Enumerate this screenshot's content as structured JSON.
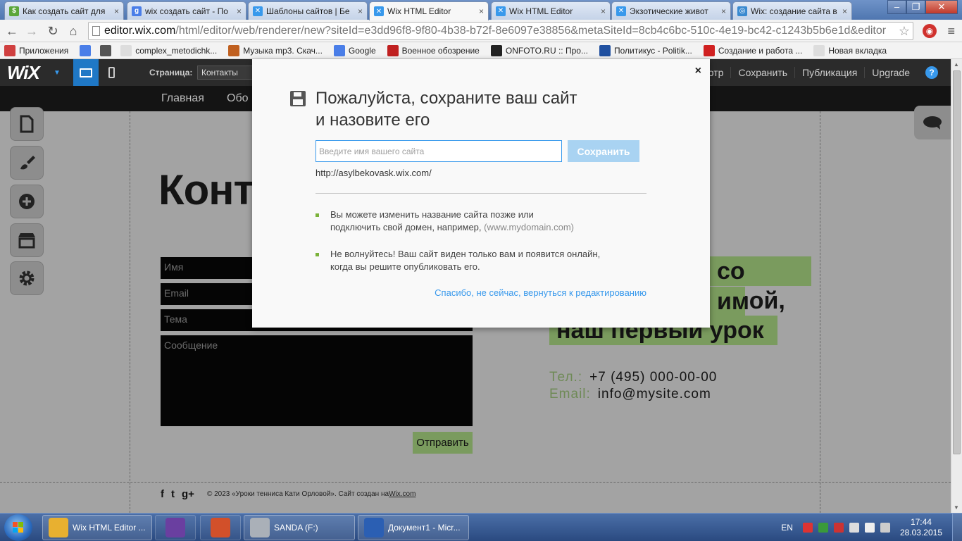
{
  "browser": {
    "tabs": [
      {
        "title": "Как создать сайт для",
        "fav": "$",
        "color": "#5ba63a"
      },
      {
        "title": "wix создать сайт - По",
        "fav": "g",
        "color": "#4a7ee8"
      },
      {
        "title": "Шаблоны сайтов | Бе",
        "fav": "✕",
        "color": "#3899ec"
      },
      {
        "title": "Wix HTML Editor",
        "fav": "✕",
        "color": "#3899ec"
      },
      {
        "title": "Wix HTML Editor",
        "fav": "✕",
        "color": "#3899ec"
      },
      {
        "title": "Экзотические живот",
        "fav": "✕",
        "color": "#3899ec"
      },
      {
        "title": "Wix: создание сайта в",
        "fav": "◎",
        "color": "#3a8ad0"
      }
    ],
    "url_host": "editor.wix.com",
    "url_path": "/html/editor/web/renderer/new?siteId=e3dd96f8-9f80-4b38-b72f-8e6097e38856&metaSiteId=8cb4c6bc-510c-4e19-bc42-c1243b5b6e1d&editor",
    "bookmarks": [
      {
        "label": "Приложения",
        "color": "#d04040"
      },
      {
        "label": "",
        "color": "#4a7ee8"
      },
      {
        "label": "",
        "color": "#555555"
      },
      {
        "label": "complex_metodichk...",
        "color": "#dddddd"
      },
      {
        "label": "Музыка mp3. Скач...",
        "color": "#c06020"
      },
      {
        "label": "Google",
        "color": "#4a7ee8"
      },
      {
        "label": "Военное обозрение",
        "color": "#c02020"
      },
      {
        "label": "ONFOTO.RU :: Про...",
        "color": "#222222"
      },
      {
        "label": "Политикус - Politik...",
        "color": "#2050a0"
      },
      {
        "label": "Создание и работа ...",
        "color": "#d02020"
      },
      {
        "label": "Новая вкладка",
        "color": "#dddddd"
      }
    ]
  },
  "wix": {
    "logo": "WiX",
    "page_label": "Страница:",
    "page_value": "Контакты",
    "menu": [
      "отр",
      "Сохранить",
      "Публикация",
      "Upgrade"
    ],
    "help": "?"
  },
  "site": {
    "nav": [
      "Главная",
      "Обо"
    ],
    "heading": "Конта",
    "form": {
      "name": "Имя",
      "email": "Email",
      "subject": "Тема",
      "message": "Сообщение",
      "send": "Отправить"
    },
    "promo_lines": [
      "со мной,",
      "им",
      "наш первый урок"
    ],
    "phone_label": "Тел.:",
    "phone": "+7 (495) 000-00-00",
    "email_label": "Email:",
    "email": "info@mysite.com",
    "footer_text": "© 2023 «Уроки тенниса Кати Орловой». Сайт создан на ",
    "footer_link": "Wix.com",
    "social": [
      "f",
      "t",
      "g+"
    ]
  },
  "modal": {
    "title_line1": "Пожалуйста, сохраните ваш сайт",
    "title_line2": "и назовите его",
    "input_placeholder": "Введите имя вашего сайта",
    "save_button": "Сохранить",
    "site_url": "http://asylbekovask.wix.com/",
    "bullet1_line1": "Вы можете изменить название сайта позже или",
    "bullet1_line2": "подключить свой домен, например, ",
    "bullet1_example": "(www.mydomain.com)",
    "bullet2_line1": "Не волнуйтесь! Ваш сайт виден только вам и появится онлайн,",
    "bullet2_line2": "когда вы решите опубликовать его.",
    "later_link": "Спасибо, не сейчас, вернуться к редактированию",
    "close": "×"
  },
  "taskbar": {
    "apps": [
      {
        "label": "Wix HTML Editor ...",
        "color": "#e8b030"
      },
      {
        "label": "",
        "color": "#6a3fa0"
      },
      {
        "label": "",
        "color": "#d2502a"
      },
      {
        "label": "SANDA (F:)",
        "color": "#aab0b8"
      },
      {
        "label": "Документ1 - Micr...",
        "color": "#2b5fb3"
      }
    ],
    "lang": "EN",
    "time": "17:44",
    "date": "28.03.2015"
  }
}
